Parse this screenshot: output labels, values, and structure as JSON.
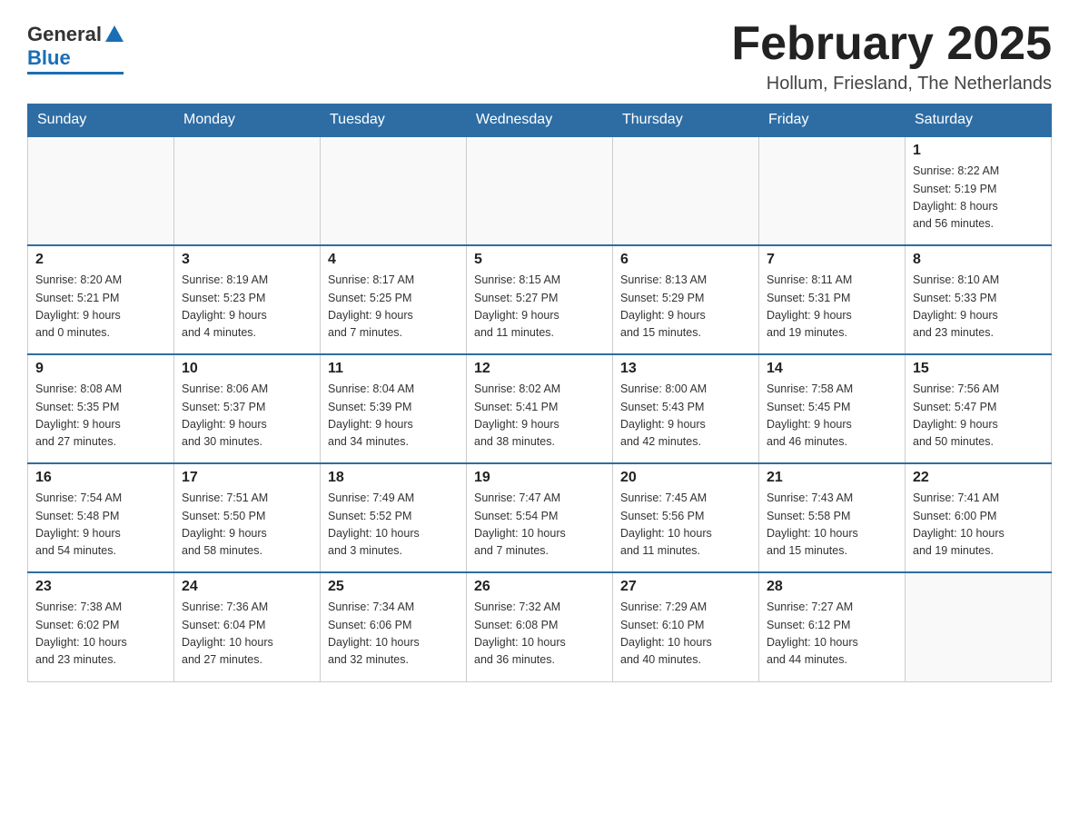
{
  "header": {
    "logo_general": "General",
    "logo_blue": "Blue",
    "month_title": "February 2025",
    "location": "Hollum, Friesland, The Netherlands"
  },
  "days_of_week": [
    "Sunday",
    "Monday",
    "Tuesday",
    "Wednesday",
    "Thursday",
    "Friday",
    "Saturday"
  ],
  "weeks": [
    {
      "days": [
        {
          "num": "",
          "info": ""
        },
        {
          "num": "",
          "info": ""
        },
        {
          "num": "",
          "info": ""
        },
        {
          "num": "",
          "info": ""
        },
        {
          "num": "",
          "info": ""
        },
        {
          "num": "",
          "info": ""
        },
        {
          "num": "1",
          "info": "Sunrise: 8:22 AM\nSunset: 5:19 PM\nDaylight: 8 hours\nand 56 minutes."
        }
      ]
    },
    {
      "days": [
        {
          "num": "2",
          "info": "Sunrise: 8:20 AM\nSunset: 5:21 PM\nDaylight: 9 hours\nand 0 minutes."
        },
        {
          "num": "3",
          "info": "Sunrise: 8:19 AM\nSunset: 5:23 PM\nDaylight: 9 hours\nand 4 minutes."
        },
        {
          "num": "4",
          "info": "Sunrise: 8:17 AM\nSunset: 5:25 PM\nDaylight: 9 hours\nand 7 minutes."
        },
        {
          "num": "5",
          "info": "Sunrise: 8:15 AM\nSunset: 5:27 PM\nDaylight: 9 hours\nand 11 minutes."
        },
        {
          "num": "6",
          "info": "Sunrise: 8:13 AM\nSunset: 5:29 PM\nDaylight: 9 hours\nand 15 minutes."
        },
        {
          "num": "7",
          "info": "Sunrise: 8:11 AM\nSunset: 5:31 PM\nDaylight: 9 hours\nand 19 minutes."
        },
        {
          "num": "8",
          "info": "Sunrise: 8:10 AM\nSunset: 5:33 PM\nDaylight: 9 hours\nand 23 minutes."
        }
      ]
    },
    {
      "days": [
        {
          "num": "9",
          "info": "Sunrise: 8:08 AM\nSunset: 5:35 PM\nDaylight: 9 hours\nand 27 minutes."
        },
        {
          "num": "10",
          "info": "Sunrise: 8:06 AM\nSunset: 5:37 PM\nDaylight: 9 hours\nand 30 minutes."
        },
        {
          "num": "11",
          "info": "Sunrise: 8:04 AM\nSunset: 5:39 PM\nDaylight: 9 hours\nand 34 minutes."
        },
        {
          "num": "12",
          "info": "Sunrise: 8:02 AM\nSunset: 5:41 PM\nDaylight: 9 hours\nand 38 minutes."
        },
        {
          "num": "13",
          "info": "Sunrise: 8:00 AM\nSunset: 5:43 PM\nDaylight: 9 hours\nand 42 minutes."
        },
        {
          "num": "14",
          "info": "Sunrise: 7:58 AM\nSunset: 5:45 PM\nDaylight: 9 hours\nand 46 minutes."
        },
        {
          "num": "15",
          "info": "Sunrise: 7:56 AM\nSunset: 5:47 PM\nDaylight: 9 hours\nand 50 minutes."
        }
      ]
    },
    {
      "days": [
        {
          "num": "16",
          "info": "Sunrise: 7:54 AM\nSunset: 5:48 PM\nDaylight: 9 hours\nand 54 minutes."
        },
        {
          "num": "17",
          "info": "Sunrise: 7:51 AM\nSunset: 5:50 PM\nDaylight: 9 hours\nand 58 minutes."
        },
        {
          "num": "18",
          "info": "Sunrise: 7:49 AM\nSunset: 5:52 PM\nDaylight: 10 hours\nand 3 minutes."
        },
        {
          "num": "19",
          "info": "Sunrise: 7:47 AM\nSunset: 5:54 PM\nDaylight: 10 hours\nand 7 minutes."
        },
        {
          "num": "20",
          "info": "Sunrise: 7:45 AM\nSunset: 5:56 PM\nDaylight: 10 hours\nand 11 minutes."
        },
        {
          "num": "21",
          "info": "Sunrise: 7:43 AM\nSunset: 5:58 PM\nDaylight: 10 hours\nand 15 minutes."
        },
        {
          "num": "22",
          "info": "Sunrise: 7:41 AM\nSunset: 6:00 PM\nDaylight: 10 hours\nand 19 minutes."
        }
      ]
    },
    {
      "days": [
        {
          "num": "23",
          "info": "Sunrise: 7:38 AM\nSunset: 6:02 PM\nDaylight: 10 hours\nand 23 minutes."
        },
        {
          "num": "24",
          "info": "Sunrise: 7:36 AM\nSunset: 6:04 PM\nDaylight: 10 hours\nand 27 minutes."
        },
        {
          "num": "25",
          "info": "Sunrise: 7:34 AM\nSunset: 6:06 PM\nDaylight: 10 hours\nand 32 minutes."
        },
        {
          "num": "26",
          "info": "Sunrise: 7:32 AM\nSunset: 6:08 PM\nDaylight: 10 hours\nand 36 minutes."
        },
        {
          "num": "27",
          "info": "Sunrise: 7:29 AM\nSunset: 6:10 PM\nDaylight: 10 hours\nand 40 minutes."
        },
        {
          "num": "28",
          "info": "Sunrise: 7:27 AM\nSunset: 6:12 PM\nDaylight: 10 hours\nand 44 minutes."
        },
        {
          "num": "",
          "info": ""
        }
      ]
    }
  ]
}
